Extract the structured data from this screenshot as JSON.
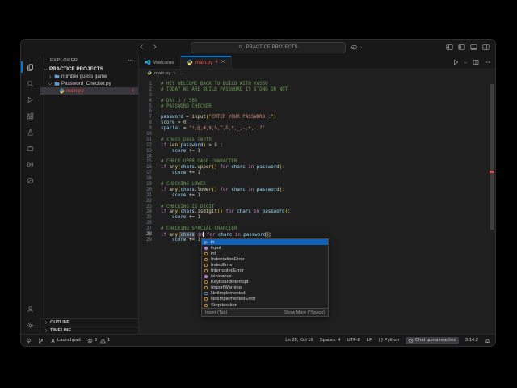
{
  "title_bar": {
    "search": "PRACTICE PROJECTS",
    "nav_icons": [
      "arrow-left",
      "arrow-right"
    ],
    "right_menu_icons": [
      "copilot-menu",
      "chevron-down"
    ],
    "layout_icons": [
      "layout-customize",
      "layout-sidebar-left",
      "layout-panel",
      "layout-sidebar-right"
    ]
  },
  "activity_bar": {
    "top": [
      {
        "icon": "explorer",
        "active": true
      },
      {
        "icon": "search",
        "active": false
      },
      {
        "icon": "run-debug",
        "active": false
      },
      {
        "icon": "extensions",
        "active": false
      },
      {
        "icon": "testing",
        "active": false
      },
      {
        "icon": "remote-explorer",
        "active": false
      },
      {
        "icon": "run-circle",
        "active": false
      },
      {
        "icon": "live-share",
        "active": false
      }
    ],
    "bottom": [
      {
        "icon": "account",
        "active": false
      },
      {
        "icon": "settings",
        "active": false
      }
    ]
  },
  "sidebar": {
    "header": "EXPLORER",
    "header_action_icon": "more-actions",
    "tree": [
      {
        "label": "PRACTICE PROJECTS",
        "kind": "root",
        "chevron": "down",
        "bold": true
      },
      {
        "label": "number guess game",
        "kind": "folder",
        "chevron": "right"
      },
      {
        "label": "Password_Checker.py",
        "kind": "folder",
        "chevron": "down"
      },
      {
        "label": "main.py",
        "kind": "python-file",
        "selected": true,
        "error": true,
        "badge": "4"
      }
    ],
    "panels": [
      {
        "label": "OUTLINE"
      },
      {
        "label": "TIMELINE"
      }
    ]
  },
  "editor": {
    "tabs": [
      {
        "label": "Welcome",
        "icon": "vscode",
        "active": false,
        "error": false,
        "badge": "",
        "closable": false
      },
      {
        "label": "main.py",
        "icon": "python",
        "active": true,
        "error": true,
        "badge": "4",
        "closable": true
      }
    ],
    "actions": [
      "run",
      "chevron-down",
      "split-editor",
      "more-actions"
    ],
    "breadcrumb": {
      "file": "main.py",
      "rest": "…"
    },
    "cursor_position": "Ln 28, Col 16",
    "lines": [
      {
        "n": 1,
        "t": [
          [
            "c",
            "# HEY WELCOME BACK TO BUILD WITH YASSU"
          ]
        ]
      },
      {
        "n": 2,
        "t": [
          [
            "c",
            "# TODAY WE ARE BUILD PASSWORD IS STONG OR NOT"
          ]
        ]
      },
      {
        "n": 3,
        "t": []
      },
      {
        "n": 4,
        "t": [
          [
            "c",
            "# DAY 3 / 365"
          ]
        ]
      },
      {
        "n": 5,
        "t": [
          [
            "c",
            "# PASSWORD CHECKER"
          ]
        ]
      },
      {
        "n": 6,
        "t": []
      },
      {
        "n": 7,
        "t": [
          [
            "v",
            "password"
          ],
          [
            "o",
            " = "
          ],
          [
            "f",
            "input"
          ],
          [
            "b",
            "("
          ],
          [
            "s",
            "\"ENTER YOUR PASSWORD :\""
          ],
          [
            "b",
            ")"
          ]
        ]
      },
      {
        "n": 8,
        "t": [
          [
            "v",
            "score"
          ],
          [
            "o",
            " = "
          ],
          [
            "n",
            "0"
          ]
        ]
      },
      {
        "n": 9,
        "t": [
          [
            "v",
            "spacial"
          ],
          [
            "o",
            " = "
          ],
          [
            "s",
            "\"!,@,#,$,%,^,&,*,_,-,+,.,?\""
          ]
        ]
      },
      {
        "n": 10,
        "t": []
      },
      {
        "n": 11,
        "t": [
          [
            "c",
            "# check pass lenth"
          ]
        ]
      },
      {
        "n": 12,
        "t": [
          [
            "k",
            "if "
          ],
          [
            "f",
            "len"
          ],
          [
            "b",
            "("
          ],
          [
            "v",
            "password"
          ],
          [
            "b",
            ")"
          ],
          [
            "o",
            " > "
          ],
          [
            "n",
            "8"
          ],
          [
            "o",
            " :"
          ]
        ]
      },
      {
        "n": 13,
        "t": [
          [
            "p",
            "    "
          ],
          [
            "v",
            "score"
          ],
          [
            "o",
            " += "
          ],
          [
            "n",
            "1"
          ]
        ]
      },
      {
        "n": 14,
        "t": []
      },
      {
        "n": 15,
        "t": [
          [
            "c",
            "# CHECK UPER CASE CHARACTER"
          ]
        ]
      },
      {
        "n": 16,
        "t": [
          [
            "k",
            "if "
          ],
          [
            "f",
            "any"
          ],
          [
            "b",
            "("
          ],
          [
            "v",
            "chars"
          ],
          [
            "p",
            "."
          ],
          [
            "f",
            "upper"
          ],
          [
            "b",
            "()"
          ],
          [
            "p",
            " "
          ],
          [
            "k",
            "for"
          ],
          [
            "v",
            " charc "
          ],
          [
            "k",
            "in"
          ],
          [
            "v",
            " password"
          ],
          [
            "b",
            ")"
          ],
          [
            "p",
            ":"
          ]
        ]
      },
      {
        "n": 17,
        "t": [
          [
            "p",
            "    "
          ],
          [
            "v",
            "score"
          ],
          [
            "o",
            " += "
          ],
          [
            "n",
            "1"
          ]
        ]
      },
      {
        "n": 18,
        "t": []
      },
      {
        "n": 19,
        "t": [
          [
            "c",
            "# CHECKING LOWER"
          ]
        ]
      },
      {
        "n": 20,
        "t": [
          [
            "k",
            "if "
          ],
          [
            "f",
            "any"
          ],
          [
            "b",
            "("
          ],
          [
            "v",
            "chars"
          ],
          [
            "p",
            "."
          ],
          [
            "f",
            "lower"
          ],
          [
            "b",
            "()"
          ],
          [
            "p",
            " "
          ],
          [
            "k",
            "for"
          ],
          [
            "v",
            " charc "
          ],
          [
            "k",
            "in"
          ],
          [
            "v",
            " password"
          ],
          [
            "b",
            ")"
          ],
          [
            "p",
            ":"
          ]
        ]
      },
      {
        "n": 21,
        "t": [
          [
            "p",
            "    "
          ],
          [
            "v",
            "score"
          ],
          [
            "o",
            " += "
          ],
          [
            "n",
            "1"
          ]
        ]
      },
      {
        "n": 22,
        "t": []
      },
      {
        "n": 23,
        "t": [
          [
            "c",
            "# CHECKING IS DIGIT"
          ]
        ]
      },
      {
        "n": 24,
        "t": [
          [
            "k",
            "if "
          ],
          [
            "f",
            "any"
          ],
          [
            "b",
            "("
          ],
          [
            "v",
            "chars"
          ],
          [
            "p",
            "."
          ],
          [
            "f",
            "isdigit"
          ],
          [
            "b",
            "()"
          ],
          [
            "p",
            " "
          ],
          [
            "k",
            "for"
          ],
          [
            "v",
            " chars "
          ],
          [
            "k",
            "in"
          ],
          [
            "v",
            " password"
          ],
          [
            "b",
            ")"
          ],
          [
            "p",
            ":"
          ]
        ]
      },
      {
        "n": 25,
        "t": [
          [
            "p",
            "    "
          ],
          [
            "v",
            "score"
          ],
          [
            "o",
            " += "
          ],
          [
            "n",
            "1"
          ]
        ]
      },
      {
        "n": 26,
        "t": []
      },
      {
        "n": 27,
        "t": [
          [
            "c",
            "# CHACKING SPACIAL CHARCTER"
          ]
        ]
      },
      {
        "n": 28,
        "active": true,
        "t": [
          [
            "k",
            "if "
          ],
          [
            "f",
            "any"
          ],
          [
            "b",
            "("
          ],
          [
            "vb",
            "chars"
          ],
          [
            "k",
            " in"
          ],
          [
            "cur",
            ""
          ],
          [
            "p",
            " "
          ],
          [
            "ke",
            "for"
          ],
          [
            "v",
            " charc "
          ],
          [
            "k",
            "in"
          ],
          [
            "v",
            " password"
          ],
          [
            "bb",
            ")"
          ],
          [
            "p",
            ":"
          ]
        ]
      },
      {
        "n": 29,
        "t": [
          [
            "p",
            "    "
          ],
          [
            "v",
            "score"
          ],
          [
            "o",
            " += "
          ],
          [
            "n",
            "1"
          ]
        ]
      }
    ]
  },
  "suggest": {
    "items": [
      {
        "label": "in",
        "kind": "keyword",
        "selected": true
      },
      {
        "label": "input",
        "kind": "method",
        "selected": false
      },
      {
        "label": "int",
        "kind": "class",
        "selected": false
      },
      {
        "label": "IndentationError",
        "kind": "class",
        "selected": false
      },
      {
        "label": "IndexError",
        "kind": "class",
        "selected": false
      },
      {
        "label": "InterruptedError",
        "kind": "class",
        "selected": false
      },
      {
        "label": "isinstance",
        "kind": "method",
        "selected": false
      },
      {
        "label": "KeyboardInterrupt",
        "kind": "class",
        "selected": false
      },
      {
        "label": "ImportWarning",
        "kind": "class",
        "selected": false
      },
      {
        "label": "NotImplemented",
        "kind": "variable",
        "selected": false
      },
      {
        "label": "NotImplementedError",
        "kind": "class",
        "selected": false
      },
      {
        "label": "StopIteration",
        "kind": "class",
        "selected": false
      }
    ],
    "footer_left": "Insert (Tab)",
    "footer_right": "Show More (^Space)"
  },
  "status_bar": {
    "left": [
      {
        "icon": "remote",
        "label": ""
      },
      {
        "icon": "git-branch",
        "label": ""
      },
      {
        "icon": "rocket",
        "label": "Launchpad"
      },
      {
        "parts": [
          {
            "icon": "error",
            "label": "3"
          },
          {
            "icon": "warning",
            "label": "1"
          }
        ]
      }
    ],
    "right": [
      {
        "label": "Ln 28, Col 16"
      },
      {
        "label": "Spaces: 4"
      },
      {
        "label": "UTF-8"
      },
      {
        "label": "LF"
      },
      {
        "icon": "braces",
        "label": "Python"
      },
      {
        "icon": "copilot",
        "label": "Chat quota reached",
        "boxed": true
      },
      {
        "label": "3.14.2"
      },
      {
        "icon": "bell",
        "label": ""
      }
    ]
  },
  "colors": {
    "accent_blue": "#0078d4",
    "error_red": "#f14c4c",
    "suggest_selected": "#0e62b9",
    "token_comment": "#6A9955",
    "token_keyword": "#C586C0",
    "token_function": "#DCDCAA",
    "token_variable": "#9CDCFE",
    "token_string": "#CE9178",
    "token_number": "#B5CEA8",
    "token_default": "#D4D4D4",
    "token_bracket": "#FFD700",
    "kind_method": "#B180D7",
    "kind_class": "#EE9D28",
    "kind_keyword": "#CFCFCF",
    "kind_variable": "#75BEFF",
    "python_blue": "#4584b6",
    "python_yellow": "#ffde57"
  }
}
